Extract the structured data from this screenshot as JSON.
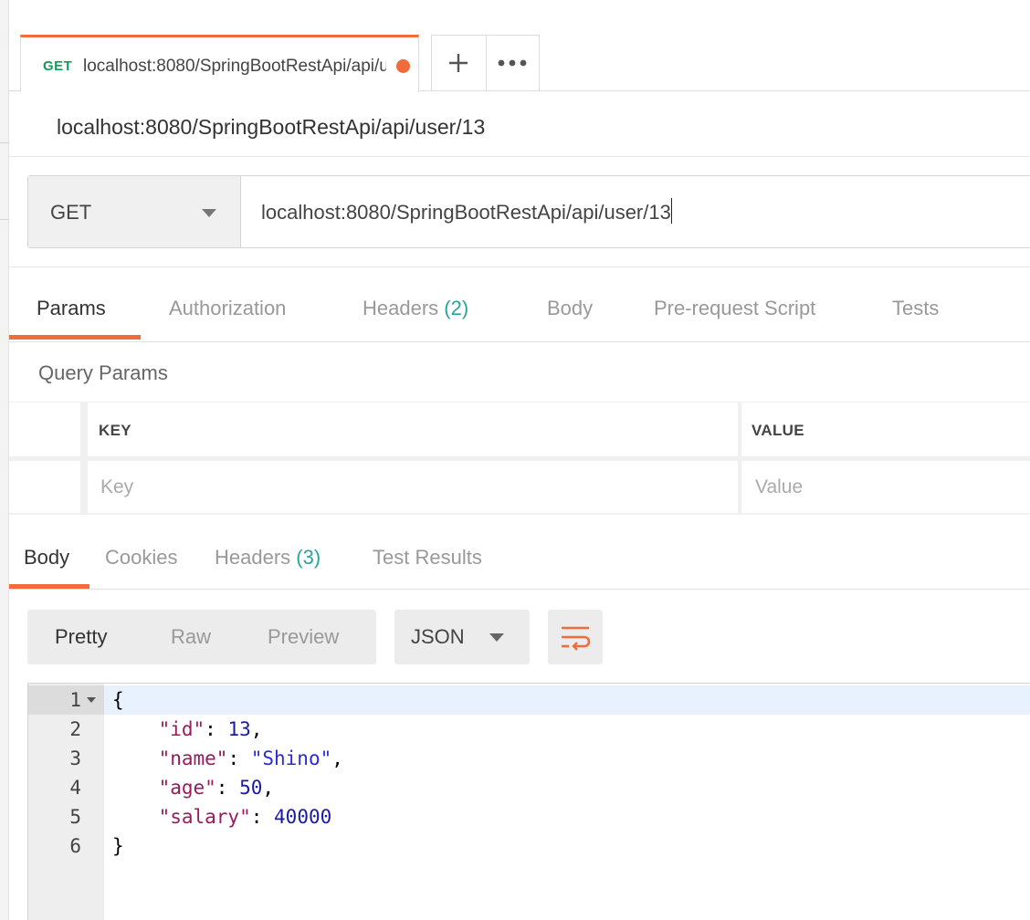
{
  "request_tab": {
    "method": "GET",
    "title": "localhost:8080/SpringBootRestApi/api/user/13",
    "add_tab": "+",
    "more": "•••"
  },
  "request_name": "localhost:8080/SpringBootRestApi/api/user/13",
  "url_bar": {
    "method": "GET",
    "url": "localhost:8080/SpringBootRestApi/api/user/13"
  },
  "request_tabs": [
    {
      "label": "Params"
    },
    {
      "label": "Authorization"
    },
    {
      "label": "Headers",
      "count": "(2)"
    },
    {
      "label": "Body"
    },
    {
      "label": "Pre-request Script"
    },
    {
      "label": "Tests"
    }
  ],
  "query_params": {
    "title": "Query Params",
    "key_header": "KEY",
    "value_header": "VALUE",
    "key_placeholder": "Key",
    "value_placeholder": "Value"
  },
  "response_tabs": [
    {
      "label": "Body"
    },
    {
      "label": "Cookies"
    },
    {
      "label": "Headers",
      "count": "(3)"
    },
    {
      "label": "Test Results"
    }
  ],
  "format": {
    "modes": [
      "Pretty",
      "Raw",
      "Preview"
    ],
    "language": "JSON"
  },
  "response_body": {
    "line_numbers": [
      "1",
      "2",
      "3",
      "4",
      "5",
      "6"
    ],
    "open_brace": "{",
    "close_brace": "}",
    "fields": [
      {
        "key": "\"id\"",
        "value": "13",
        "trail": ","
      },
      {
        "key": "\"name\"",
        "value": "\"Shino\"",
        "trail": ","
      },
      {
        "key": "\"age\"",
        "value": "50",
        "trail": ","
      },
      {
        "key": "\"salary\"",
        "value": "40000",
        "trail": ""
      }
    ]
  },
  "colors": {
    "accent": "#f26b3a",
    "get_method": "#0f9d58",
    "count": "#26a69a",
    "json_key": "#9a1b5b",
    "json_number": "#1a1aa6"
  },
  "icons": {
    "add_tab": "plus-icon",
    "more": "ellipsis-icon",
    "wrap": "wrap-lines-icon",
    "method_caret": "chevron-down-icon"
  }
}
